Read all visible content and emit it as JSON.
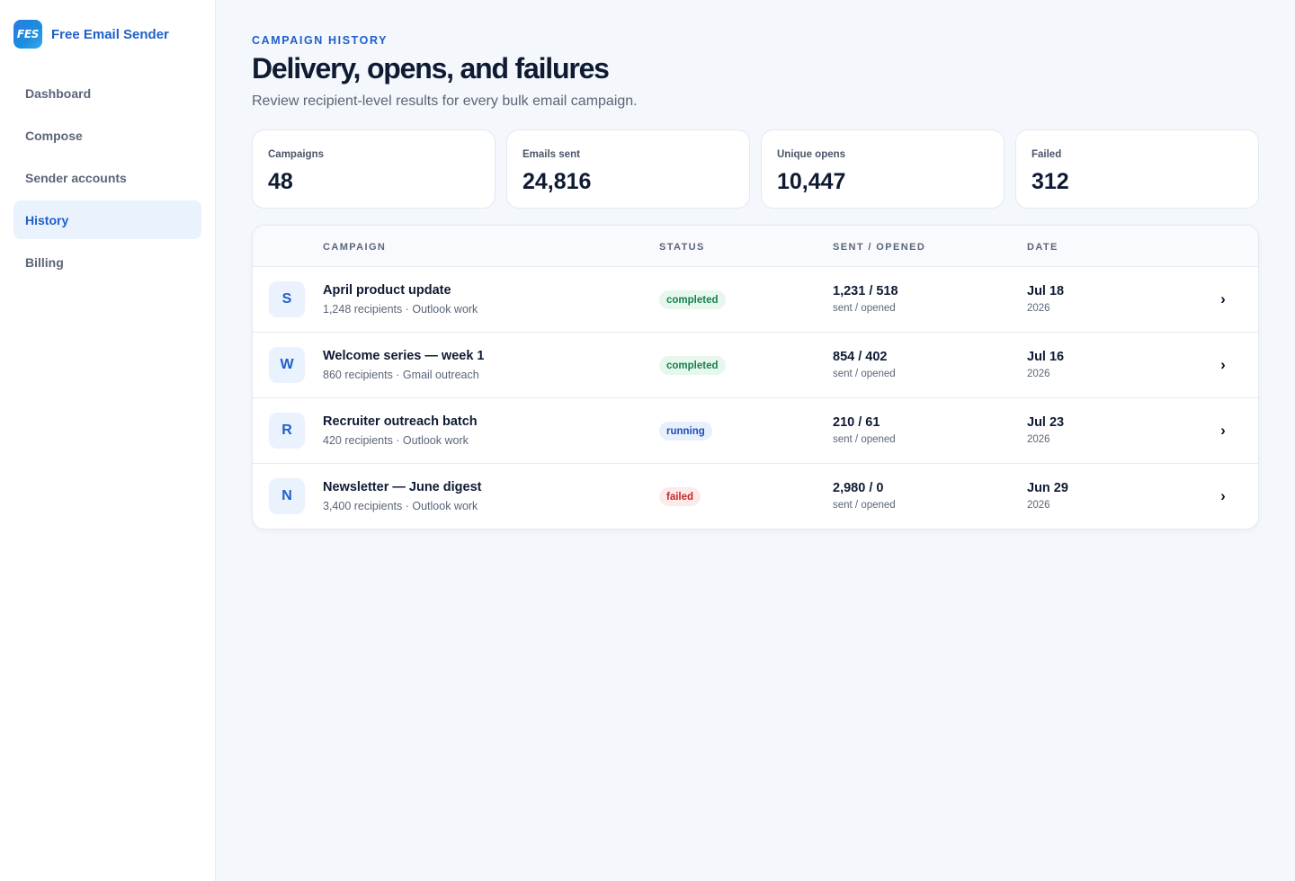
{
  "app": {
    "logo_text": "FES",
    "name": "Free Email Sender"
  },
  "nav": [
    {
      "label": "Dashboard",
      "active": false
    },
    {
      "label": "Compose",
      "active": false
    },
    {
      "label": "Sender accounts",
      "active": false
    },
    {
      "label": "History",
      "active": true
    },
    {
      "label": "Billing",
      "active": false
    }
  ],
  "header": {
    "eyebrow": "CAMPAIGN HISTORY",
    "title": "Delivery, opens, and failures",
    "subtitle": "Review recipient-level results for every bulk email campaign."
  },
  "stats": [
    {
      "label": "Campaigns",
      "value": "48"
    },
    {
      "label": "Emails sent",
      "value": "24,816"
    },
    {
      "label": "Unique opens",
      "value": "10,447"
    },
    {
      "label": "Failed",
      "value": "312"
    }
  ],
  "table": {
    "columns": [
      "CAMPAIGN",
      "STATUS",
      "SENT / OPENED",
      "DATE"
    ],
    "rows": [
      {
        "initial": "S",
        "name": "April product update",
        "meta": "1,248 recipients · Outlook work",
        "status": "completed",
        "sent_opened": "1,231 / 518",
        "sent_opened_label": "sent / opened",
        "date": "Jul 18",
        "year": "2026",
        "chevron": "›"
      },
      {
        "initial": "W",
        "name": "Welcome series — week 1",
        "meta": "860 recipients · Gmail outreach",
        "status": "completed",
        "sent_opened": "854 / 402",
        "sent_opened_label": "sent / opened",
        "date": "Jul 16",
        "year": "2026",
        "chevron": "›"
      },
      {
        "initial": "R",
        "name": "Recruiter outreach batch",
        "meta": "420 recipients · Outlook work",
        "status": "running",
        "sent_opened": "210 / 61",
        "sent_opened_label": "sent / opened",
        "date": "Jul 23",
        "year": "2026",
        "chevron": "›"
      },
      {
        "initial": "N",
        "name": "Newsletter — June digest",
        "meta": "3,400 recipients · Outlook work",
        "status": "failed",
        "sent_opened": "2,980 / 0",
        "sent_opened_label": "sent / opened",
        "date": "Jun 29",
        "year": "2026",
        "chevron": "›"
      }
    ]
  },
  "colors": {
    "accent": "#1f5fc9",
    "completed": "#16804a",
    "running": "#1f4fb3",
    "failed": "#c62828"
  }
}
